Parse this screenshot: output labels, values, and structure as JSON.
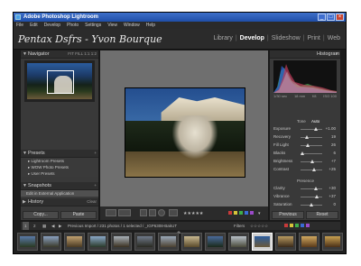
{
  "window": {
    "title": "Adobe Photoshop Lightroom"
  },
  "menu": [
    "File",
    "Edit",
    "Develop",
    "Photo",
    "Settings",
    "View",
    "Window",
    "Help"
  ],
  "identity_plate": "Pentax Dsfrs - Yvon Bourque",
  "modules": [
    "Library",
    "Develop",
    "Slideshow",
    "Print",
    "Web"
  ],
  "active_module": "Develop",
  "left_panel": {
    "navigator": {
      "title": "Navigator",
      "zoom_options": "FIT  FILL  1:1  1:2"
    },
    "presets": {
      "title": "Presets",
      "items": [
        "Lightroom Presets",
        "WOW Photo Presets",
        "User Presets"
      ]
    },
    "snapshots": {
      "title": "Snapshots",
      "items": [
        "Edit in External Application"
      ]
    },
    "history": {
      "title": "History",
      "clear_label": "Clear"
    },
    "copy_label": "Copy...",
    "paste_label": "Paste"
  },
  "right_panel": {
    "histogram": {
      "title": "Histogram",
      "labels": [
        "1/30 sec",
        "18 mm",
        "f/8",
        "ISO 100"
      ]
    },
    "tone_header": "Tone",
    "auto_label": "Auto",
    "tone_controls": [
      {
        "label": "Exposure",
        "value": "+1.00",
        "pos": 0.7
      },
      {
        "label": "Recovery",
        "value": "19",
        "pos": 0.3
      },
      {
        "label": "Fill Light",
        "value": "26",
        "pos": 0.35
      },
      {
        "label": "Blacks",
        "value": "6",
        "pos": 0.1
      },
      {
        "label": "Brightness",
        "value": "+7",
        "pos": 0.55
      },
      {
        "label": "Contrast",
        "value": "+25",
        "pos": 0.62
      }
    ],
    "presence_header": "Presence",
    "presence_controls": [
      {
        "label": "Clarity",
        "value": "+30",
        "pos": 0.72
      },
      {
        "label": "Vibrance",
        "value": "+37",
        "pos": 0.75
      },
      {
        "label": "Saturation",
        "value": "0",
        "pos": 0.5
      }
    ],
    "previous_label": "Previous",
    "reset_label": "Reset"
  },
  "filmstrip": {
    "page_left": "1",
    "page_right": "2",
    "status": "Previous Import / 231 photos / 1 selected / _IGP6308-BakUT",
    "filters_label": "Filters",
    "selected_index": 10,
    "thumbs": 14
  },
  "colors": {
    "panel": "#393939",
    "canvas": "#6f6f6f",
    "title_blue": "#1f4ea8",
    "label_red": "#c83a3a",
    "label_yellow": "#d6c43a",
    "label_green": "#3fae4a",
    "label_blue": "#3a6bd6",
    "label_purple": "#9a4ac8"
  }
}
